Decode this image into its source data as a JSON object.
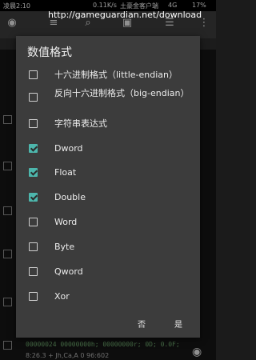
{
  "status": {
    "time": "凌晨2:10",
    "speed": "0.11K/s",
    "carrier": "土豪金客户端",
    "network": "4G",
    "battery": "17%"
  },
  "url_overlay": "http://gameguardian.net/download",
  "background": {
    "row_address": "00000024",
    "row_values": "00000000h; 00000000r; 0D; 0.0F;",
    "row_sub": "8:26.3 + Jh,Ca,A  0 96:602"
  },
  "dialog": {
    "title": "数值格式",
    "options": [
      {
        "label": "十六进制格式（little-endian）",
        "checked": false
      },
      {
        "label": "反向十六进制格式（big-endian）",
        "checked": false
      },
      {
        "label": "字符串表达式",
        "checked": false
      },
      {
        "label": "Dword",
        "checked": true
      },
      {
        "label": "Float",
        "checked": true
      },
      {
        "label": "Double",
        "checked": true
      },
      {
        "label": "Word",
        "checked": false
      },
      {
        "label": "Byte",
        "checked": false
      },
      {
        "label": "Qword",
        "checked": false
      },
      {
        "label": "Xor",
        "checked": false
      }
    ],
    "no_label": "否",
    "yes_label": "是"
  },
  "colors": {
    "accent": "#4db6ac",
    "dialog_bg": "#3c3c3c"
  }
}
